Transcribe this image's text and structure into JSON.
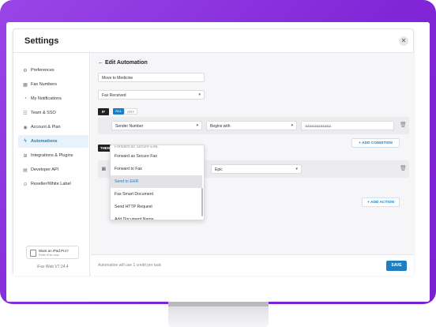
{
  "window": {
    "title": "Settings",
    "close": "✕"
  },
  "sidebar": {
    "items": [
      {
        "label": "Preferences",
        "icon": "sliders-icon",
        "glyph": "⚙"
      },
      {
        "label": "Fax Numbers",
        "icon": "grid-icon",
        "glyph": "▦"
      },
      {
        "label": "My Notifications",
        "icon": "bell-icon",
        "glyph": "◔"
      },
      {
        "label": "Team & SSO",
        "icon": "team-icon",
        "glyph": "☷"
      },
      {
        "label": "Account & Plan",
        "icon": "account-icon",
        "glyph": "◉"
      },
      {
        "label": "Automations",
        "icon": "automation-icon",
        "glyph": "ϟ"
      },
      {
        "label": "Integrations & Plugins",
        "icon": "integrations-icon",
        "glyph": "⊞"
      },
      {
        "label": "Developer API",
        "icon": "api-icon",
        "glyph": "▤"
      },
      {
        "label": "Reseller/White Label",
        "icon": "reseller-icon",
        "glyph": "⊙"
      }
    ],
    "active_index": 5,
    "ipad_promo": {
      "title": "Want an iPad Pro?",
      "subtitle": "Refer iFax now"
    },
    "version": "iFax Web V7.24.4"
  },
  "editor": {
    "back_arrow": "←",
    "title": "Edit Automation",
    "name_value": "Move to Medicine",
    "trigger_value": "Fax Received",
    "if_label": "IF",
    "match_all": "ALL",
    "match_any": "ANY",
    "condition": {
      "field": "Sender Number",
      "operator": "Begins with",
      "value": "1111111111111111111"
    },
    "add_condition": "+ ADD CONDITION",
    "then_label": "THEN",
    "action": {
      "target": "Epic"
    },
    "add_action": "+ ADD ACTION",
    "chevron": "▾",
    "trash": "🗑"
  },
  "dropdown": {
    "partial_item": "Forward as Secure EML",
    "items": [
      "Forward as Secure Fax",
      "Forward to Fax",
      "Send to EHR",
      "Fax Smart Document",
      "Send HTTP Request",
      "Add Document Name"
    ],
    "selected_index": 2
  },
  "footer": {
    "credit_note": "Automation will use 1 credit per task",
    "save": "SAVE"
  },
  "colors": {
    "frame": "#8a2de0",
    "accent": "#1d7fc1"
  }
}
